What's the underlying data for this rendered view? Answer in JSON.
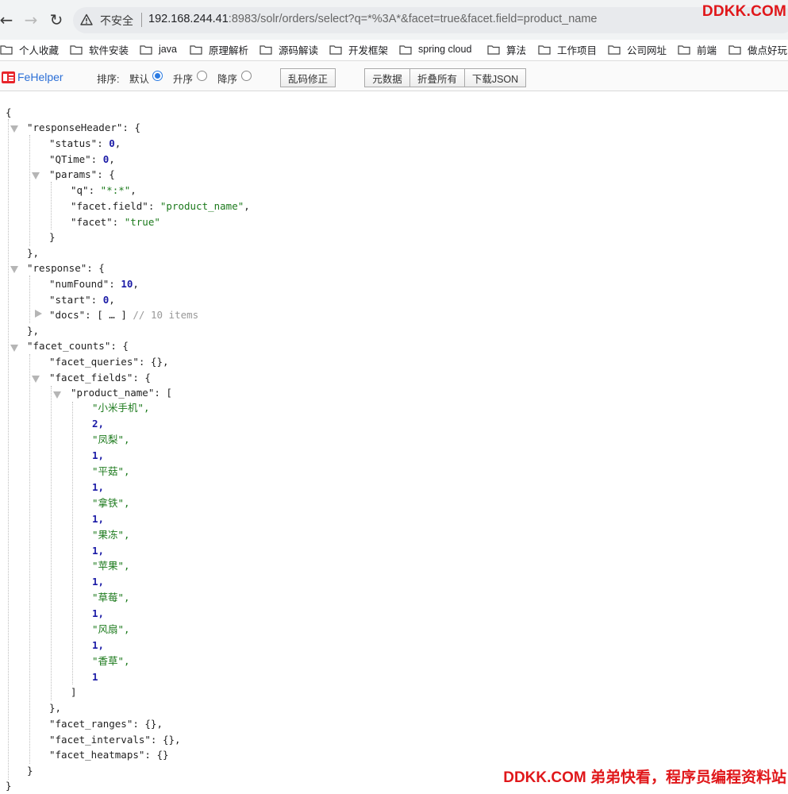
{
  "browser": {
    "insecure_label": "不安全",
    "url_host": "192.168.244.41",
    "url_rest": ":8983/solr/orders/select?q=*%3A*&facet=true&facet.field=product_name",
    "brand": "DDKK.COM"
  },
  "bookmarks": [
    {
      "label": "个人收藏"
    },
    {
      "label": "软件安装"
    },
    {
      "label": "java"
    },
    {
      "label": "原理解析"
    },
    {
      "label": "源码解读"
    },
    {
      "label": "开发框架"
    },
    {
      "label": "spring cloud"
    },
    {
      "label": "算法"
    },
    {
      "label": "工作项目"
    },
    {
      "label": "公司网址"
    },
    {
      "label": "前端"
    },
    {
      "label": "做点好玩的"
    }
  ],
  "fehelper": {
    "name": "FeHelper",
    "sort_label": "排序:",
    "sort_default": "默认",
    "sort_asc": "升序",
    "sort_desc": "降序",
    "selected_sort": "默认",
    "fix_encoding": "乱码修正",
    "metadata": "元数据",
    "collapse_all": "折叠所有",
    "download_json": "下载JSON"
  },
  "json": {
    "l01": "{",
    "l02": "\"responseHeader\": {",
    "l03a": "\"status\": ",
    "l03b": "0",
    "l03c": ",",
    "l04a": "\"QTime\": ",
    "l04b": "0",
    "l04c": ",",
    "l05": "\"params\": {",
    "l06a": "\"q\": ",
    "l06b": "\"*:*\"",
    "l06c": ",",
    "l07a": "\"facet.field\": ",
    "l07b": "\"product_name\"",
    "l07c": ",",
    "l08a": "\"facet\": ",
    "l08b": "\"true\"",
    "l09": "}",
    "l10": "},",
    "l11": "\"response\": {",
    "l12a": "\"numFound\": ",
    "l12b": "10",
    "l12c": ",",
    "l13a": "\"start\": ",
    "l13b": "0",
    "l13c": ",",
    "l14a": "\"docs\": ",
    "l14b": "[ … ]",
    "l14c": " // 10 items",
    "l15": "},",
    "l16": "\"facet_counts\": {",
    "l17": "\"facet_queries\": {},",
    "l18": "\"facet_fields\": {",
    "l19": "\"product_name\": [",
    "facets": [
      {
        "name": "\"小米手机\",",
        "count": "2,"
      },
      {
        "name": "\"凤梨\",",
        "count": "1,"
      },
      {
        "name": "\"平菇\",",
        "count": "1,"
      },
      {
        "name": "\"拿铁\",",
        "count": "1,"
      },
      {
        "name": "\"果冻\",",
        "count": "1,"
      },
      {
        "name": "\"苹果\",",
        "count": "1,"
      },
      {
        "name": "\"草莓\",",
        "count": "1,"
      },
      {
        "name": "\"风扇\",",
        "count": "1,"
      },
      {
        "name": "\"香草\",",
        "count": "1"
      }
    ],
    "l38": "]",
    "l39": "},",
    "l40": "\"facet_ranges\": {},",
    "l41": "\"facet_intervals\": {},",
    "l42": "\"facet_heatmaps\": {}",
    "l43": "}",
    "l44": "}"
  },
  "watermark": "DDKK.COM 弟弟快看，程序员编程资料站"
}
